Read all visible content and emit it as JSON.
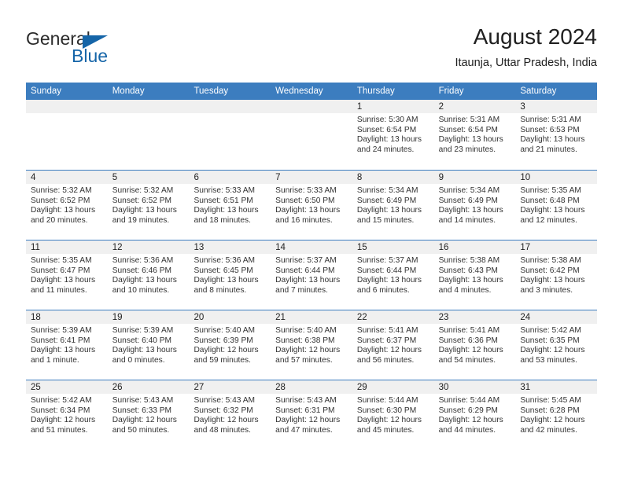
{
  "brand": {
    "name_part1": "General",
    "name_part2": "Blue",
    "logo_icon": "blue-triangle-logo",
    "accent_color": "#1565a8"
  },
  "header": {
    "title": "August 2024",
    "location": "Itaunja, Uttar Pradesh, India"
  },
  "calendar": {
    "header_color": "#3c7dbf",
    "weekdays": [
      "Sunday",
      "Monday",
      "Tuesday",
      "Wednesday",
      "Thursday",
      "Friday",
      "Saturday"
    ],
    "weeks": [
      [
        {
          "day": "",
          "sunrise": "",
          "sunset": "",
          "daylight_line1": "",
          "daylight_line2": ""
        },
        {
          "day": "",
          "sunrise": "",
          "sunset": "",
          "daylight_line1": "",
          "daylight_line2": ""
        },
        {
          "day": "",
          "sunrise": "",
          "sunset": "",
          "daylight_line1": "",
          "daylight_line2": ""
        },
        {
          "day": "",
          "sunrise": "",
          "sunset": "",
          "daylight_line1": "",
          "daylight_line2": ""
        },
        {
          "day": "1",
          "sunrise": "Sunrise: 5:30 AM",
          "sunset": "Sunset: 6:54 PM",
          "daylight_line1": "Daylight: 13 hours",
          "daylight_line2": "and 24 minutes."
        },
        {
          "day": "2",
          "sunrise": "Sunrise: 5:31 AM",
          "sunset": "Sunset: 6:54 PM",
          "daylight_line1": "Daylight: 13 hours",
          "daylight_line2": "and 23 minutes."
        },
        {
          "day": "3",
          "sunrise": "Sunrise: 5:31 AM",
          "sunset": "Sunset: 6:53 PM",
          "daylight_line1": "Daylight: 13 hours",
          "daylight_line2": "and 21 minutes."
        }
      ],
      [
        {
          "day": "4",
          "sunrise": "Sunrise: 5:32 AM",
          "sunset": "Sunset: 6:52 PM",
          "daylight_line1": "Daylight: 13 hours",
          "daylight_line2": "and 20 minutes."
        },
        {
          "day": "5",
          "sunrise": "Sunrise: 5:32 AM",
          "sunset": "Sunset: 6:52 PM",
          "daylight_line1": "Daylight: 13 hours",
          "daylight_line2": "and 19 minutes."
        },
        {
          "day": "6",
          "sunrise": "Sunrise: 5:33 AM",
          "sunset": "Sunset: 6:51 PM",
          "daylight_line1": "Daylight: 13 hours",
          "daylight_line2": "and 18 minutes."
        },
        {
          "day": "7",
          "sunrise": "Sunrise: 5:33 AM",
          "sunset": "Sunset: 6:50 PM",
          "daylight_line1": "Daylight: 13 hours",
          "daylight_line2": "and 16 minutes."
        },
        {
          "day": "8",
          "sunrise": "Sunrise: 5:34 AM",
          "sunset": "Sunset: 6:49 PM",
          "daylight_line1": "Daylight: 13 hours",
          "daylight_line2": "and 15 minutes."
        },
        {
          "day": "9",
          "sunrise": "Sunrise: 5:34 AM",
          "sunset": "Sunset: 6:49 PM",
          "daylight_line1": "Daylight: 13 hours",
          "daylight_line2": "and 14 minutes."
        },
        {
          "day": "10",
          "sunrise": "Sunrise: 5:35 AM",
          "sunset": "Sunset: 6:48 PM",
          "daylight_line1": "Daylight: 13 hours",
          "daylight_line2": "and 12 minutes."
        }
      ],
      [
        {
          "day": "11",
          "sunrise": "Sunrise: 5:35 AM",
          "sunset": "Sunset: 6:47 PM",
          "daylight_line1": "Daylight: 13 hours",
          "daylight_line2": "and 11 minutes."
        },
        {
          "day": "12",
          "sunrise": "Sunrise: 5:36 AM",
          "sunset": "Sunset: 6:46 PM",
          "daylight_line1": "Daylight: 13 hours",
          "daylight_line2": "and 10 minutes."
        },
        {
          "day": "13",
          "sunrise": "Sunrise: 5:36 AM",
          "sunset": "Sunset: 6:45 PM",
          "daylight_line1": "Daylight: 13 hours",
          "daylight_line2": "and 8 minutes."
        },
        {
          "day": "14",
          "sunrise": "Sunrise: 5:37 AM",
          "sunset": "Sunset: 6:44 PM",
          "daylight_line1": "Daylight: 13 hours",
          "daylight_line2": "and 7 minutes."
        },
        {
          "day": "15",
          "sunrise": "Sunrise: 5:37 AM",
          "sunset": "Sunset: 6:44 PM",
          "daylight_line1": "Daylight: 13 hours",
          "daylight_line2": "and 6 minutes."
        },
        {
          "day": "16",
          "sunrise": "Sunrise: 5:38 AM",
          "sunset": "Sunset: 6:43 PM",
          "daylight_line1": "Daylight: 13 hours",
          "daylight_line2": "and 4 minutes."
        },
        {
          "day": "17",
          "sunrise": "Sunrise: 5:38 AM",
          "sunset": "Sunset: 6:42 PM",
          "daylight_line1": "Daylight: 13 hours",
          "daylight_line2": "and 3 minutes."
        }
      ],
      [
        {
          "day": "18",
          "sunrise": "Sunrise: 5:39 AM",
          "sunset": "Sunset: 6:41 PM",
          "daylight_line1": "Daylight: 13 hours",
          "daylight_line2": "and 1 minute."
        },
        {
          "day": "19",
          "sunrise": "Sunrise: 5:39 AM",
          "sunset": "Sunset: 6:40 PM",
          "daylight_line1": "Daylight: 13 hours",
          "daylight_line2": "and 0 minutes."
        },
        {
          "day": "20",
          "sunrise": "Sunrise: 5:40 AM",
          "sunset": "Sunset: 6:39 PM",
          "daylight_line1": "Daylight: 12 hours",
          "daylight_line2": "and 59 minutes."
        },
        {
          "day": "21",
          "sunrise": "Sunrise: 5:40 AM",
          "sunset": "Sunset: 6:38 PM",
          "daylight_line1": "Daylight: 12 hours",
          "daylight_line2": "and 57 minutes."
        },
        {
          "day": "22",
          "sunrise": "Sunrise: 5:41 AM",
          "sunset": "Sunset: 6:37 PM",
          "daylight_line1": "Daylight: 12 hours",
          "daylight_line2": "and 56 minutes."
        },
        {
          "day": "23",
          "sunrise": "Sunrise: 5:41 AM",
          "sunset": "Sunset: 6:36 PM",
          "daylight_line1": "Daylight: 12 hours",
          "daylight_line2": "and 54 minutes."
        },
        {
          "day": "24",
          "sunrise": "Sunrise: 5:42 AM",
          "sunset": "Sunset: 6:35 PM",
          "daylight_line1": "Daylight: 12 hours",
          "daylight_line2": "and 53 minutes."
        }
      ],
      [
        {
          "day": "25",
          "sunrise": "Sunrise: 5:42 AM",
          "sunset": "Sunset: 6:34 PM",
          "daylight_line1": "Daylight: 12 hours",
          "daylight_line2": "and 51 minutes."
        },
        {
          "day": "26",
          "sunrise": "Sunrise: 5:43 AM",
          "sunset": "Sunset: 6:33 PM",
          "daylight_line1": "Daylight: 12 hours",
          "daylight_line2": "and 50 minutes."
        },
        {
          "day": "27",
          "sunrise": "Sunrise: 5:43 AM",
          "sunset": "Sunset: 6:32 PM",
          "daylight_line1": "Daylight: 12 hours",
          "daylight_line2": "and 48 minutes."
        },
        {
          "day": "28",
          "sunrise": "Sunrise: 5:43 AM",
          "sunset": "Sunset: 6:31 PM",
          "daylight_line1": "Daylight: 12 hours",
          "daylight_line2": "and 47 minutes."
        },
        {
          "day": "29",
          "sunrise": "Sunrise: 5:44 AM",
          "sunset": "Sunset: 6:30 PM",
          "daylight_line1": "Daylight: 12 hours",
          "daylight_line2": "and 45 minutes."
        },
        {
          "day": "30",
          "sunrise": "Sunrise: 5:44 AM",
          "sunset": "Sunset: 6:29 PM",
          "daylight_line1": "Daylight: 12 hours",
          "daylight_line2": "and 44 minutes."
        },
        {
          "day": "31",
          "sunrise": "Sunrise: 5:45 AM",
          "sunset": "Sunset: 6:28 PM",
          "daylight_line1": "Daylight: 12 hours",
          "daylight_line2": "and 42 minutes."
        }
      ]
    ]
  }
}
